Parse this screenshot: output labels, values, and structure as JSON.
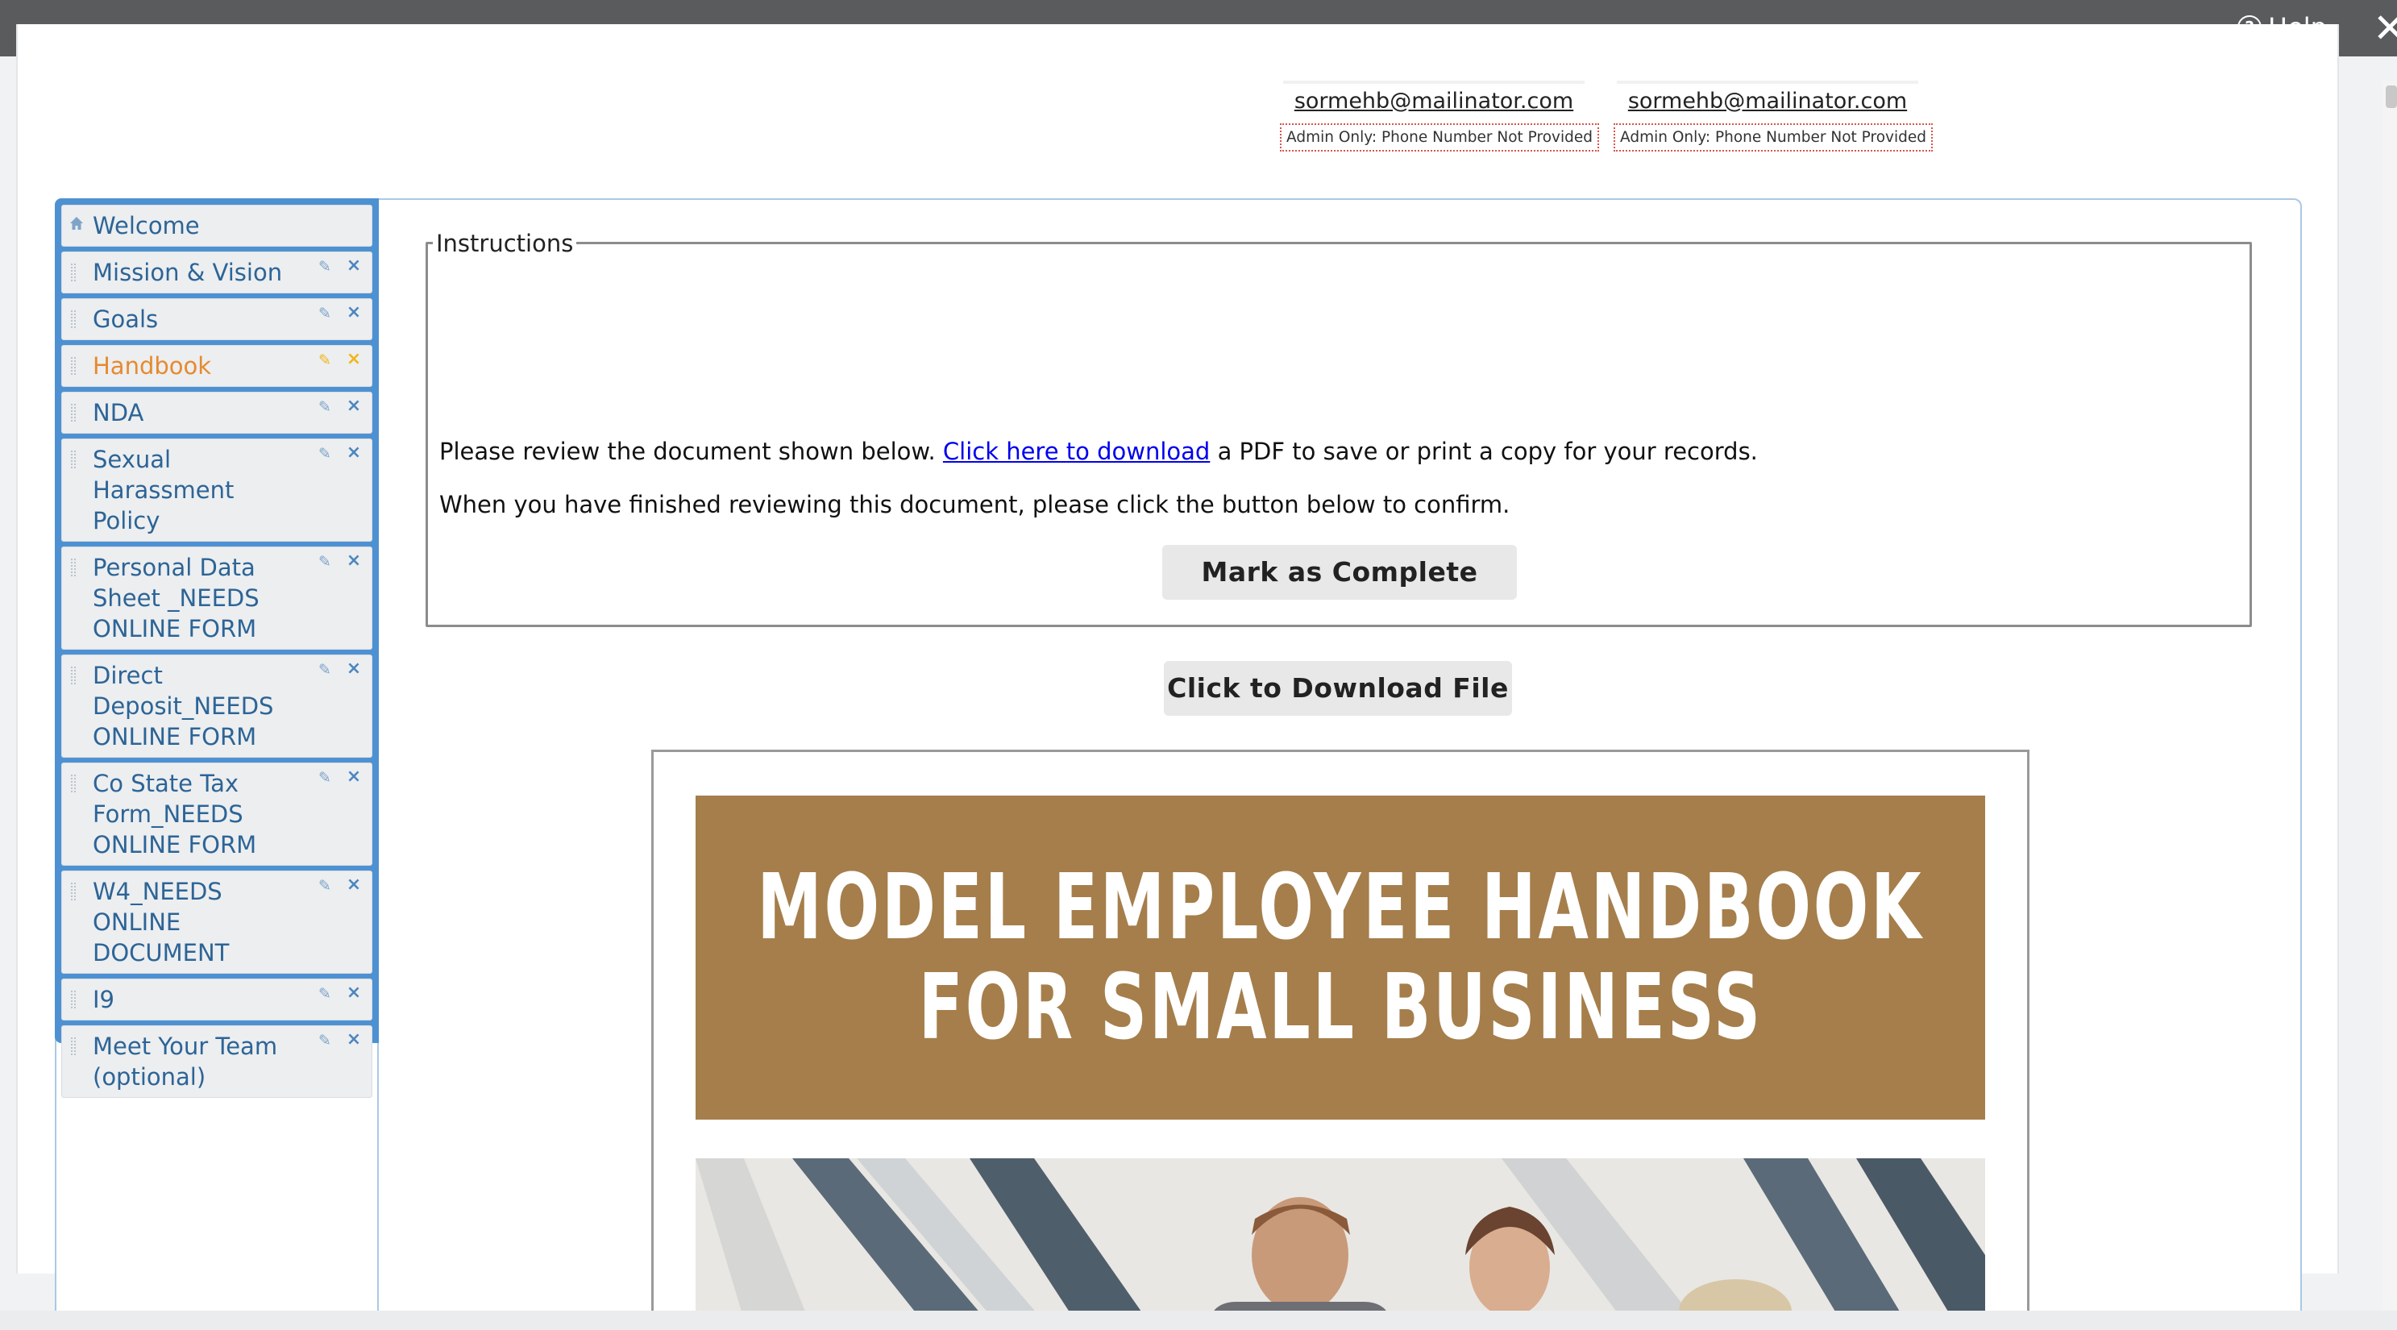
{
  "topbar": {
    "help_label": "Help",
    "help_icon": "question-circle-icon",
    "close_icon": "close-icon"
  },
  "contacts": [
    {
      "email": "sormehb@mailinator.com",
      "phone_note": "Admin Only: Phone Number Not Provided"
    },
    {
      "email": "sormehb@mailinator.com",
      "phone_note": "Admin Only: Phone Number Not Provided"
    }
  ],
  "sidebar": {
    "items": [
      {
        "label": "Welcome",
        "icon": "home-icon"
      },
      {
        "label": "Mission & Vision"
      },
      {
        "label": "Goals"
      },
      {
        "label": "Handbook",
        "active": true
      },
      {
        "label": "NDA"
      },
      {
        "label": "Sexual Harassment Policy"
      },
      {
        "label": "Personal Data Sheet _NEEDS ONLINE FORM"
      },
      {
        "label": "Direct Deposit_NEEDS ONLINE FORM"
      },
      {
        "label": "Co State Tax Form_NEEDS ONLINE FORM"
      },
      {
        "label": "W4_NEEDS ONLINE DOCUMENT"
      },
      {
        "label": "I9"
      },
      {
        "label": "Meet Your Team (optional)"
      }
    ],
    "edit_icon": "pencil-icon",
    "delete_icon": "delete-x-icon",
    "accent_color": "#4e91d2",
    "active_color": "#e68a2e"
  },
  "instructions": {
    "legend": "Instructions",
    "line1_before": "Please review the document shown below.",
    "line1_link": "Click here to download",
    "line1_after": "a PDF to save or print a copy for your records.",
    "line2": "When you have finished reviewing this document, please click the button below to confirm.",
    "complete_button": "Mark as Complete"
  },
  "download_button": "Click to Download File",
  "document": {
    "title_line1": "MODEL EMPLOYEE HANDBOOK",
    "title_line2": "FOR SMALL BUSINESS",
    "banner_color": "#a57e4b"
  }
}
